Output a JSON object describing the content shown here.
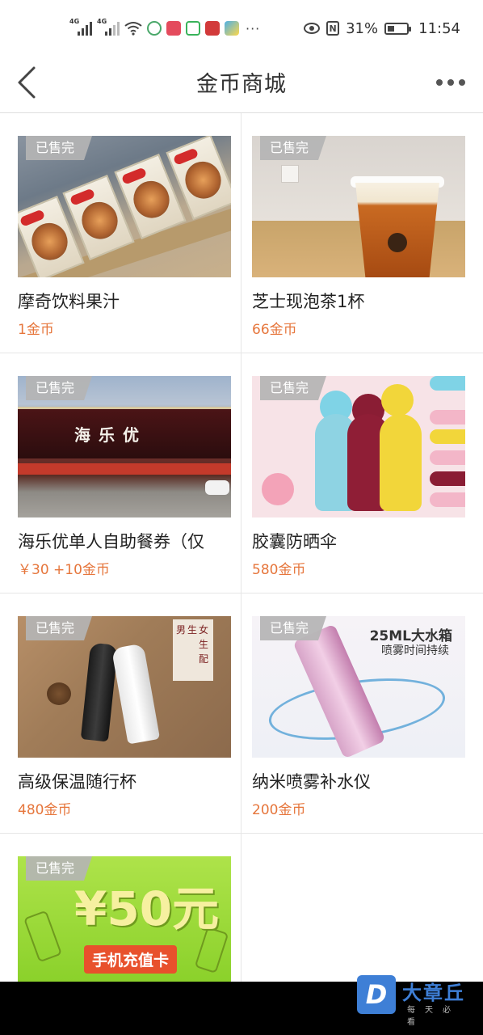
{
  "status_bar": {
    "signal1_tag": "4G",
    "signal2_tag": "4G",
    "more_indicator": "···",
    "battery_percent": "31%",
    "time": "11:54"
  },
  "nav": {
    "title": "金币商城"
  },
  "sold_out_label": "已售完",
  "products": [
    {
      "name": "摩奇饮料果汁",
      "price": "1金币"
    },
    {
      "name": "芝士现泡茶1杯",
      "price": "66金币"
    },
    {
      "name": "海乐优单人自助餐券（仅",
      "price": "￥30 +10金币"
    },
    {
      "name": "胶囊防晒伞",
      "price": "580金币"
    },
    {
      "name": "高级保温随行杯",
      "price": "480金币"
    },
    {
      "name": "纳米喷雾补水仪",
      "price": "200金币"
    }
  ],
  "pictures": {
    "store_sign": "海乐优",
    "bottle_tag": [
      "男",
      "生",
      "女",
      "生",
      "配"
    ],
    "mist_title": "25ML大水箱",
    "mist_subtitle": "喷雾时间持续",
    "card_amount": "¥50元",
    "card_label": "手机充值卡"
  },
  "watermark": {
    "mark": "D",
    "name": "大章丘",
    "sub": "每天必看"
  }
}
